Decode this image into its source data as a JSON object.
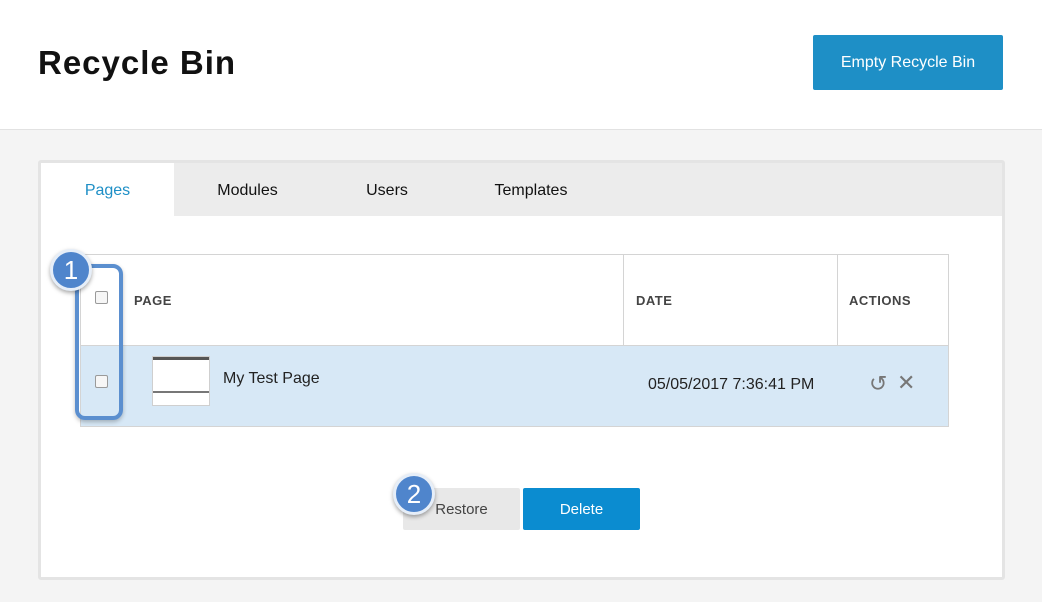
{
  "header": {
    "title": "Recycle Bin",
    "empty_button_label": "Empty Recycle Bin"
  },
  "tabs": [
    {
      "label": "Pages",
      "active": true
    },
    {
      "label": "Modules",
      "active": false
    },
    {
      "label": "Users",
      "active": false
    },
    {
      "label": "Templates",
      "active": false
    }
  ],
  "table": {
    "columns": [
      "PAGE",
      "DATE",
      "ACTIONS"
    ],
    "rows": [
      {
        "name": "My Test Page",
        "date": "05/05/2017 7:36:41 PM",
        "selected": false
      }
    ]
  },
  "buttons": {
    "restore_label": "Restore",
    "delete_label": "Delete"
  },
  "callouts": {
    "one": "1",
    "two": "2"
  },
  "icons": {
    "restore": "undo-icon",
    "delete": "close-icon"
  },
  "colors": {
    "accent": "#1e8fc6",
    "row_highlight": "#d7e8f6",
    "callout": "#4f85cc"
  }
}
